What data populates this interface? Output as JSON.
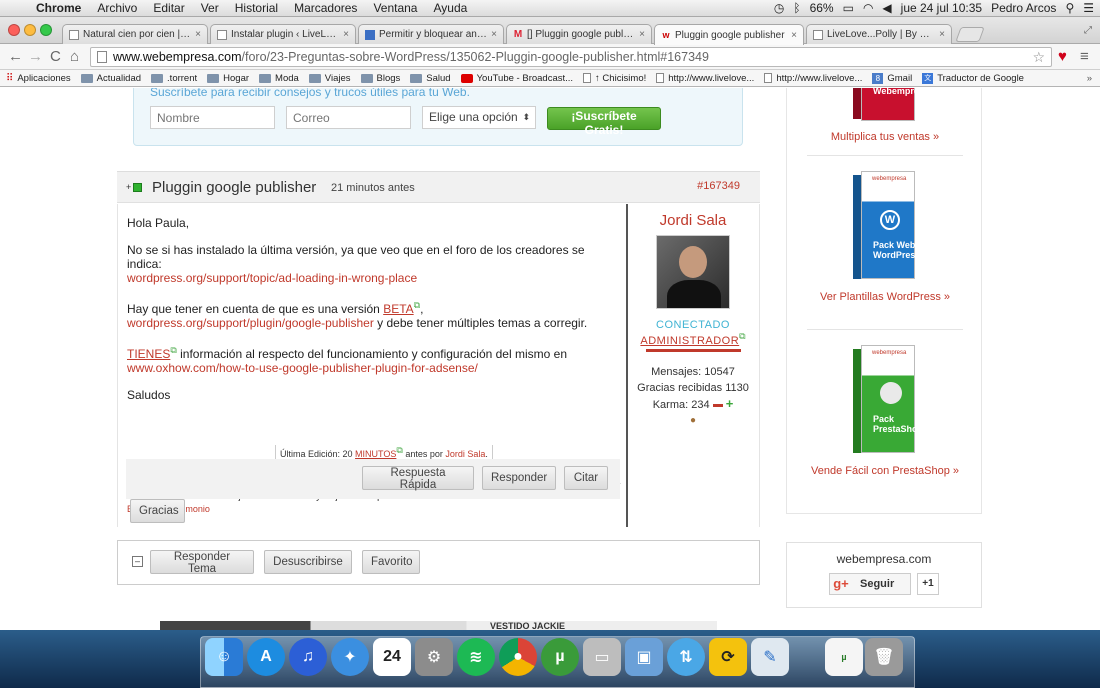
{
  "menubar": {
    "apple": "",
    "items": [
      "Chrome",
      "Archivo",
      "Editar",
      "Ver",
      "Historial",
      "Marcadores",
      "Ventana",
      "Ayuda"
    ],
    "battery": "66%",
    "clock": "jue 24 jul  10:35",
    "user": "Pedro Arcos"
  },
  "tabs": [
    {
      "title": "Natural cien por cien | Live",
      "fav": "page"
    },
    {
      "title": "Instalar plugin ‹ LiveLove...",
      "fav": "page"
    },
    {
      "title": "Permitir y bloquear anuncios",
      "fav": "blue"
    },
    {
      "title": "[] Pluggin google publisher",
      "fav": "gmail"
    },
    {
      "title": "Pluggin google publisher",
      "fav": "web"
    },
    {
      "title": "LiveLove...Polly | By Paula",
      "fav": "page"
    }
  ],
  "toolbar": {
    "url_domain": "www.webempresa.com",
    "url_path": "/foro/23-Preguntas-sobre-WordPress/135062-Pluggin-google-publisher.html#167349"
  },
  "bookmarks": [
    {
      "label": "Aplicaciones",
      "type": "apps"
    },
    {
      "label": "Actualidad",
      "type": "folder"
    },
    {
      "label": ".torrent",
      "type": "folder"
    },
    {
      "label": "Hogar",
      "type": "folder"
    },
    {
      "label": "Moda",
      "type": "folder"
    },
    {
      "label": "Viajes",
      "type": "folder"
    },
    {
      "label": "Blogs",
      "type": "folder"
    },
    {
      "label": "Salud",
      "type": "folder"
    },
    {
      "label": "YouTube - Broadcast...",
      "type": "yt"
    },
    {
      "label": "↑ Chicisimo!",
      "type": "page"
    },
    {
      "label": "http://www.livelove...",
      "type": "page"
    },
    {
      "label": "http://www.livelove...",
      "type": "page"
    },
    {
      "label": "Gmail",
      "type": "g8"
    },
    {
      "label": "Traductor de Google",
      "type": "trans"
    }
  ],
  "subscribe": {
    "intro": "Suscríbete para recibir consejos y trucos útiles para tu Web.",
    "name_placeholder": "Nombre",
    "email_placeholder": "Correo",
    "select_value": "Elige una opción",
    "button": "¡Suscríbete Gratis!"
  },
  "post": {
    "title": "Pluggin google publisher",
    "time": "21 minutos antes",
    "id": "#167349",
    "greeting": "Hola Paula,",
    "p1": "No se si has instalado la última versión, ya que veo que en el foro de los creadores se indica:",
    "link1": "wordpress.org/support/topic/ad-loading-in-wrong-place",
    "p2_pre": "Hay que tener en cuenta de que es una versión ",
    "p2_beta": "BETA",
    "p2_post": ",",
    "link2": "wordpress.org/support/plugin/google-publisher",
    "p2_tail": " y debe tener múltiples temas a corregir.",
    "tienes": "TIENES",
    "p3": " información al respecto del funcionamiento y configuración del mismo en",
    "link3": "www.oxhow.com/how-to-use-google-publisher-plugin-for-adsense/",
    "closing": "Saludos",
    "signature": "Si nuestra ayuda te sirve déjanos tu testimonio y mejora así el posicionamiento de tu web:",
    "signature_link": "Enviar mi Testimonio",
    "last_edit_pre": "Última Edición: 20 ",
    "last_edit_minutes": "MINUTOS",
    "last_edit_mid": " antes por ",
    "last_edit_by": "Jordi Sala",
    "last_edit_end": ".",
    "buttons": {
      "quick": "Respuesta Rápida",
      "reply": "Responder",
      "quote": "Citar",
      "thanks": "Gracias"
    }
  },
  "author": {
    "name": "Jordi Sala",
    "status": "CONECTADO",
    "role": "ADMINISTRADOR",
    "messages": "Mensajes: 10547",
    "thanks": "Gracias recibidas 1130",
    "karma": "Karma: 234"
  },
  "replybar": {
    "reply_topic": "Responder Tema",
    "unsubscribe": "Desuscribirse",
    "favorite": "Favorito"
  },
  "ad": {
    "text": "VESTIDO JACKIE"
  },
  "sidebar": {
    "products": [
      {
        "brand": "webempresa",
        "label": "Webempresa",
        "caption": "Multiplica tus ventas  »",
        "color": "#c8102e"
      },
      {
        "brand": "webempresa",
        "label": "Pack Web WordPress",
        "caption": "Ver Plantillas WordPress  »",
        "color": "#1f78c8"
      },
      {
        "brand": "webempresa",
        "label": "Pack PrestaShop",
        "caption": "Vende Fácil con PrestaShop  »",
        "color": "#39a935"
      }
    ],
    "domain": "webempresa.com",
    "gplus_label": "Seguir",
    "plus_one": "+1"
  }
}
